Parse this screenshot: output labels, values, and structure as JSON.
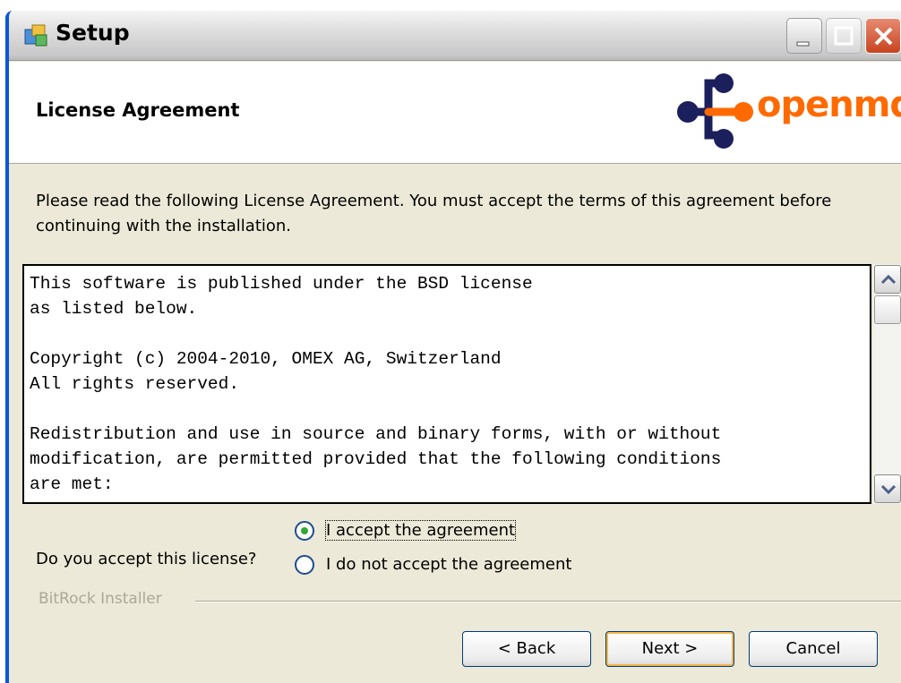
{
  "caption_fragment": "Screenshot of the Windows Setup Wizard License Agreement page",
  "window": {
    "title": "Setup",
    "controls": {
      "minimize": "minimize-icon",
      "maximize": "maximize-icon",
      "close": "close-icon"
    }
  },
  "header": {
    "title": "License Agreement",
    "logo_text": "openmdx"
  },
  "intro": "Please read the following License Agreement. You must accept the terms of this agreement before continuing with the installation.",
  "license_text": "This software is published under the BSD license\nas listed below.\n\nCopyright (c) 2004-2010, OMEX AG, Switzerland\nAll rights reserved.\n\nRedistribution and use in source and binary forms, with or without\nmodification, are permitted provided that the following conditions\nare met:",
  "accept": {
    "question": "Do you accept this license?",
    "options": [
      {
        "label": "I accept the agreement",
        "selected": true
      },
      {
        "label": "I do not accept the agreement",
        "selected": false
      }
    ]
  },
  "brand": "BitRock Installer",
  "buttons": {
    "back": "< Back",
    "next": "Next >",
    "cancel": "Cancel"
  },
  "colors": {
    "accent_orange": "#ff6a00",
    "logo_navy": "#1b1f5c",
    "radio_green": "#33a836",
    "close_red": "#c8431e"
  }
}
